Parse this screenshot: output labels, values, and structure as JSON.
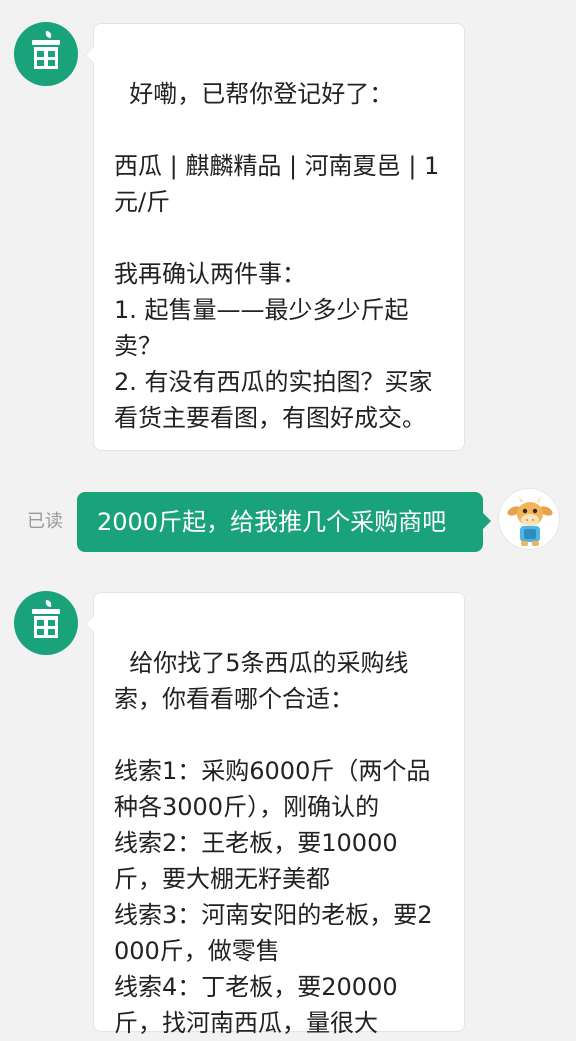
{
  "messages": [
    {
      "sender": "bot",
      "text": "好嘞，已帮你登记好了：\n\n西瓜 | 麒麟精品 | 河南夏邑 | 1元/斤\n\n我再确认两件事：\n1. 起售量——最少多少斤起卖？\n2. 有没有西瓜的实拍图？买家看货主要看图，有图好成交。"
    },
    {
      "sender": "user",
      "status": "已读",
      "text": "2000斤起，给我推几个采购商吧"
    },
    {
      "sender": "bot",
      "text": "给你找了5条西瓜的采购线索，你看看哪个合适：\n\n线索1：采购6000斤（两个品种各3000斤），刚确认的\n线索2：王老板，要10000斤，要大棚无籽美都\n线索3：河南安阳的老板，要2000斤，做零售\n线索4：丁老板，要20000斤，找河南西瓜，量很大"
    }
  ],
  "colors": {
    "accent": "#1aa27a",
    "background": "#f2f2f2",
    "bubble_white": "#ffffff",
    "text_dark": "#222222",
    "status_gray": "#9a9a9a"
  },
  "icons": {
    "bot_avatar": "shop-building-icon",
    "user_avatar": "cartoon-cow-avatar"
  }
}
